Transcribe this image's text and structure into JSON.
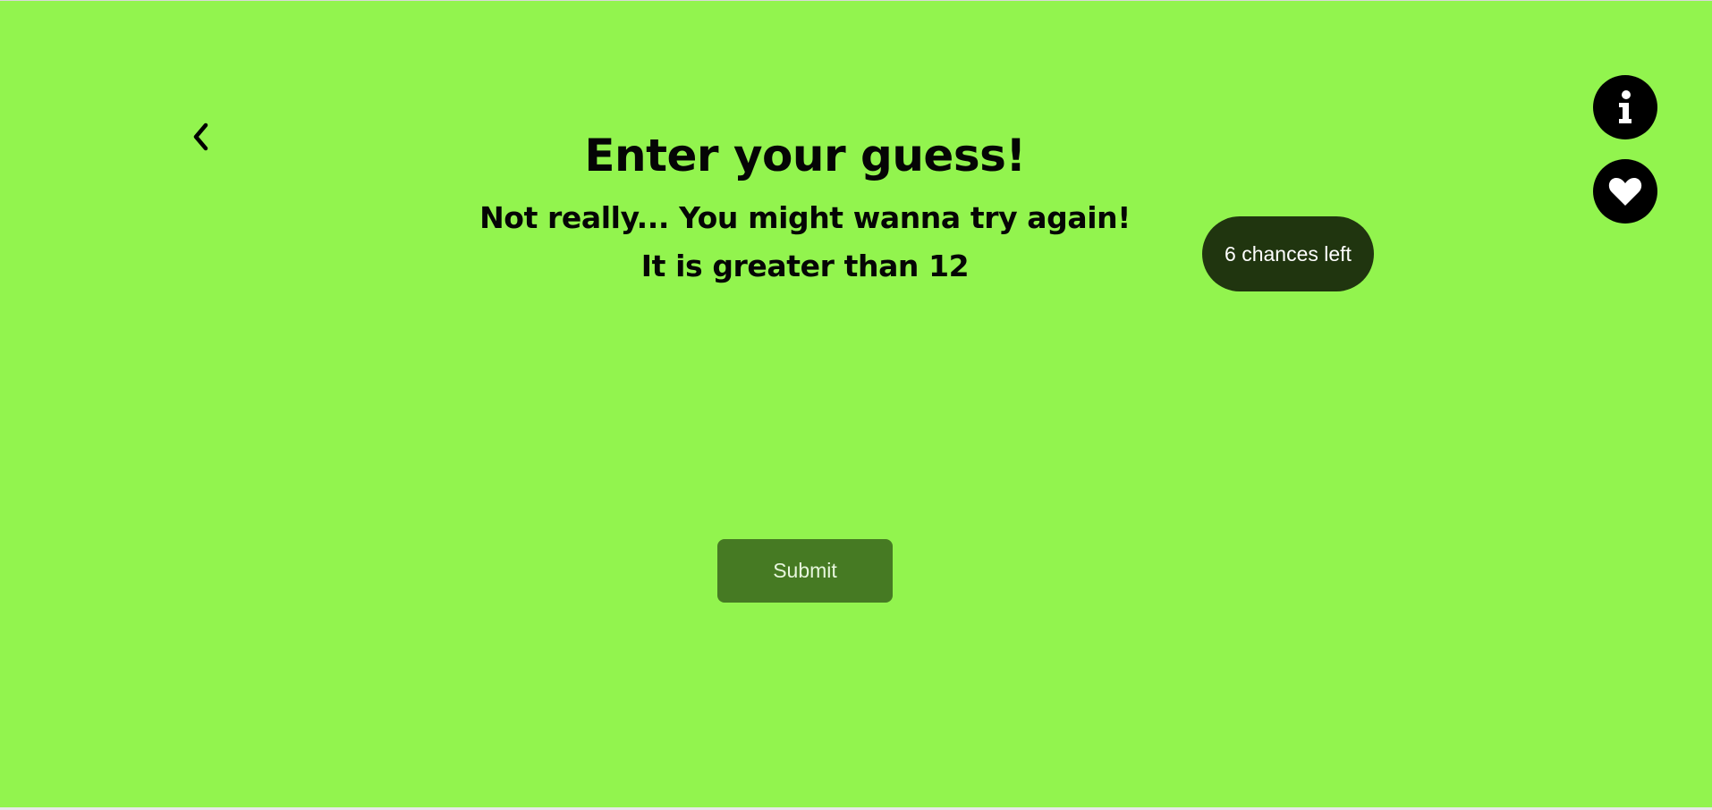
{
  "game": {
    "title": "Enter your guess!",
    "feedback": "Not really... You might wanna try again!",
    "hint": "It is greater than 12",
    "chances_label": "6 chances left",
    "submit_label": "Submit"
  },
  "icons": {
    "back": "chevron-left-icon",
    "info": "info-icon",
    "favorite": "heart-icon"
  },
  "colors": {
    "background": "#92f44e",
    "badge": "#20350f",
    "submit": "#467a23",
    "icon_button": "#000000"
  }
}
